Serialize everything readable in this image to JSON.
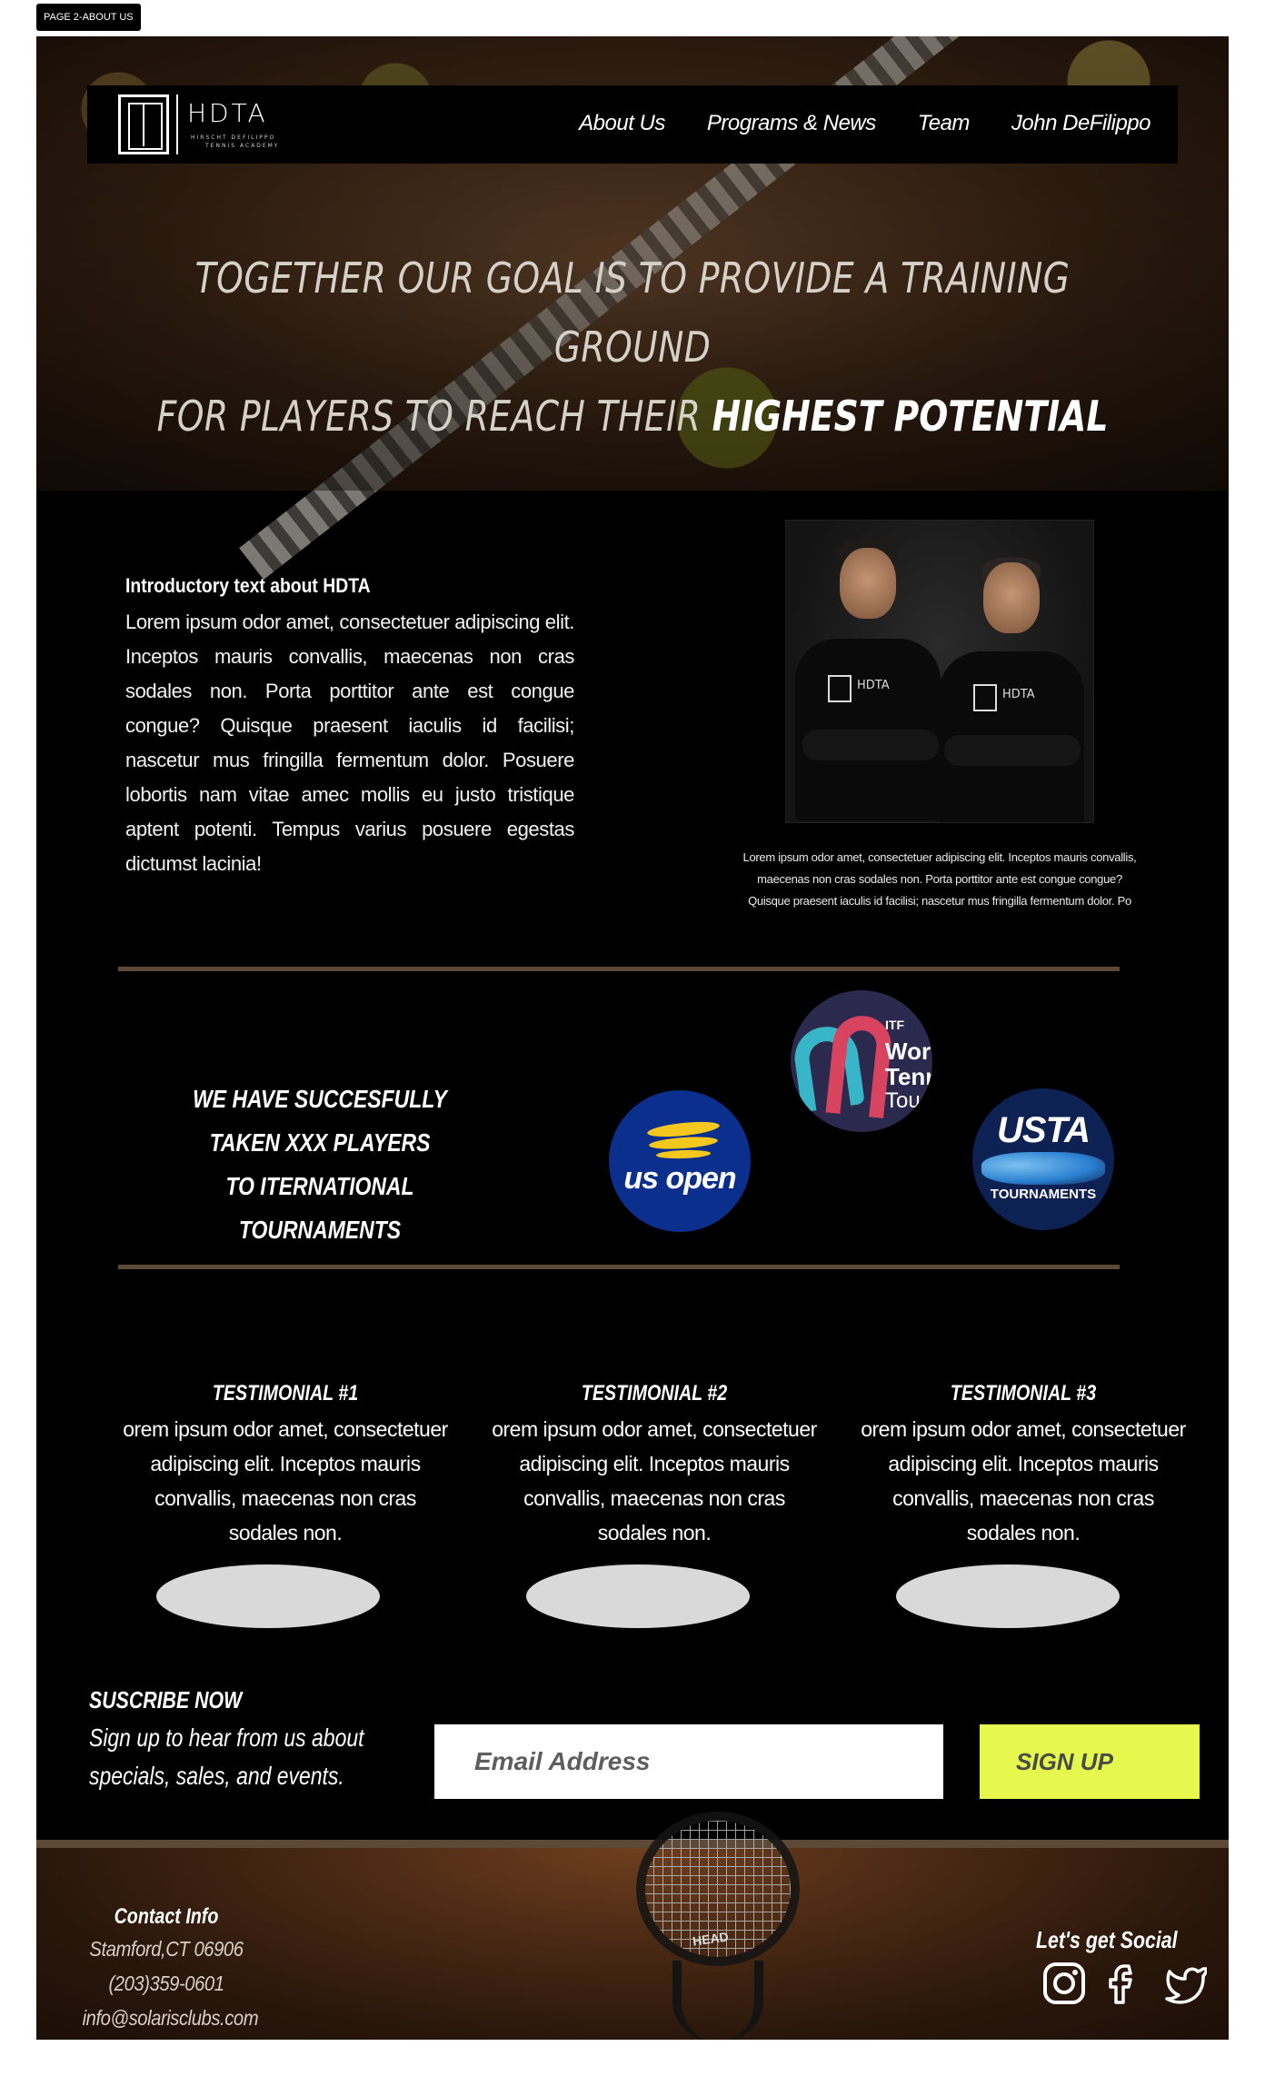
{
  "page_tag": "PAGE 2-ABOUT US",
  "logo": {
    "name": "HDTA",
    "subline1": "HIRSCHT DEFILIPPO",
    "subline2": "TENNIS ACADEMY"
  },
  "nav": {
    "items": [
      {
        "label": "About Us"
      },
      {
        "label": "Programs & News"
      },
      {
        "label": "Team"
      },
      {
        "label": "John DeFilippo"
      }
    ]
  },
  "hero": {
    "line1": "TOGETHER OUR GOAL IS TO PROVIDE A TRAINING GROUND",
    "line2": "FOR PLAYERS TO REACH THEIR ",
    "line2_emphasis": "HIGHEST POTENTIAL"
  },
  "intro": {
    "heading": "Introductory text about HDTA",
    "body": "Lorem ipsum odor amet, consectetuer adipiscing elit. Inceptos mauris convallis, maecenas non cras sodales non. Porta porttitor ante est congue congue? Quisque praesent iaculis id facilisi; nascetur mus fringilla fermentum dolor. Posuere lobortis nam vitae amec mollis eu justo tristique aptent potenti. Tempus varius posuere egestas dictumst lacinia!",
    "photo_badge": "HDTA",
    "photo_caption": "Lorem ipsum odor amet, consectetuer adipiscing elit. Inceptos mauris convallis, maecenas non cras sodales non. Porta porttitor ante est congue congue? Quisque praesent iaculis id facilisi; nascetur mus fringilla fermentum dolor. Po"
  },
  "tournaments": {
    "line1": "WE HAVE SUCCESFULLY TAKEN XXX PLAYERS",
    "line2": "TO ITERNATIONAL TOURNAMENTS",
    "logos": {
      "usopen": "us open",
      "itf_small": "ITF",
      "itf_line1": "Wor",
      "itf_line2": "Tenn",
      "itf_line3": "Tou",
      "usta": "USTA",
      "usta_sub": "TOURNAMENTS"
    }
  },
  "testimonials": [
    {
      "title": "TESTIMONIAL #1",
      "body": "orem ipsum odor amet, consectetuer adipiscing elit. Inceptos mauris convallis, maecenas non cras sodales non."
    },
    {
      "title": "TESTIMONIAL #2",
      "body": "orem ipsum odor amet, consectetuer adipiscing elit. Inceptos mauris convallis, maecenas non cras sodales non."
    },
    {
      "title": "TESTIMONIAL #3",
      "body": "orem ipsum odor amet, consectetuer adipiscing elit. Inceptos mauris convallis, maecenas non cras sodales non."
    }
  ],
  "subscribe": {
    "heading": "SUSCRIBE NOW",
    "text": "Sign up to hear from us about specials, sales, and events.",
    "email_placeholder": "Email Address",
    "button_label": "SIGN UP"
  },
  "footer": {
    "contact_title": "Contact Info",
    "address": "Stamford,CT 06906",
    "phone": "(203)359-0601",
    "email": "info@solarisclubs.com",
    "social_title": "Let's get Social",
    "racket_brand": "HEAD",
    "social_icons": [
      "instagram-icon",
      "facebook-icon",
      "twitter-icon"
    ]
  },
  "colors": {
    "accent_divider": "#5e4836",
    "signup_button": "#e6f74d",
    "background": "#000000"
  }
}
